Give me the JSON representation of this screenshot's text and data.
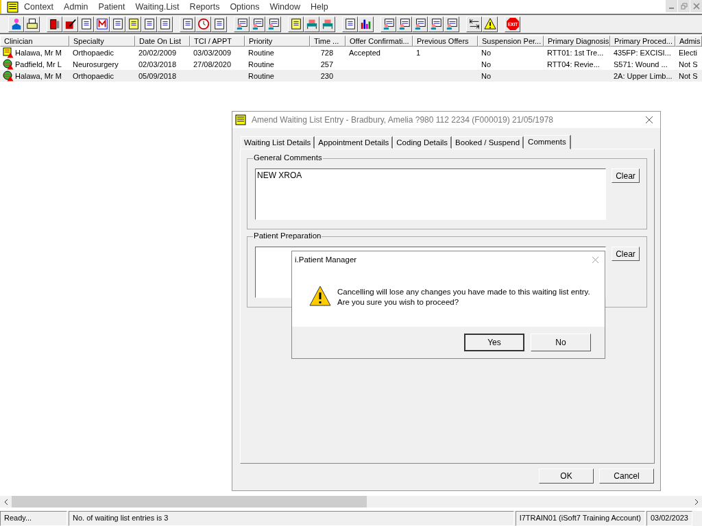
{
  "menu": [
    "Context",
    "Admin",
    "Patient",
    "Waiting.List",
    "Reports",
    "Options",
    "Window",
    "Help"
  ],
  "toolbar": {
    "exit_label": "EXIT"
  },
  "table": {
    "columns": [
      "Clinician",
      "Specialty",
      "Date On List",
      "TCI / APPT",
      "Priority",
      "Time ...",
      "Offer Confirmati...",
      "Previous Offers",
      "Suspension Per...",
      "Primary Diagnosis",
      "Primary Proced...",
      "Admis"
    ],
    "rows": [
      {
        "kind": "list-warning",
        "selected": false,
        "cells": [
          "Halawa, Mr M",
          "Orthopaedic",
          "20/02/2009",
          "03/03/2009",
          "Routine",
          "728",
          "Accepted",
          "1",
          "No",
          "RTT01: 1st Tre...",
          "435FP: EXCISI...",
          "Electi"
        ]
      },
      {
        "kind": "globe-warning",
        "selected": false,
        "cells": [
          "Padfield, Mr L",
          "Neurosurgery",
          "02/03/2018",
          "27/08/2020",
          "Routine",
          "257",
          "",
          "",
          "No",
          "RTT04: Revie...",
          "S571: Wound ...",
          "Not S"
        ]
      },
      {
        "kind": "globe-warning",
        "selected": true,
        "cells": [
          "Halawa, Mr M",
          "Orthopaedic",
          "05/09/2018",
          "",
          "Routine",
          "230",
          "",
          "",
          "No",
          "",
          "2A: Upper Limb...",
          "Not S"
        ]
      }
    ]
  },
  "dialog": {
    "title": "Amend Waiting List Entry - Bradbury, Amelia ?980 112 2234 (F000019) 21/05/1978",
    "tabs": [
      {
        "label": "Waiting List Details",
        "selected": false
      },
      {
        "label": "Appointment Details",
        "selected": false
      },
      {
        "label": "Coding Details",
        "selected": false
      },
      {
        "label": "Booked / Suspend",
        "selected": false
      },
      {
        "label": "Comments",
        "selected": true
      }
    ],
    "groups": [
      {
        "label": "General Comments",
        "value": "NEW XROA",
        "button": "Clear"
      },
      {
        "label": "Patient Preparation",
        "button": "Clear"
      }
    ],
    "buttons": [
      "OK",
      "Cancel"
    ]
  },
  "message_box": {
    "title": "i.Patient Manager",
    "message": "Cancelling will lose any changes you have made to this waiting list entry. Are you sure you wish to proceed?",
    "buttons": [
      {
        "label": "Yes",
        "selected": true
      },
      {
        "label": "No",
        "selected": false
      }
    ]
  },
  "status_bar": [
    "Ready...",
    "No. of waiting list entries is 3",
    "I7TRAIN01 (iSoft7 Training Account)",
    "03/02/2023"
  ]
}
